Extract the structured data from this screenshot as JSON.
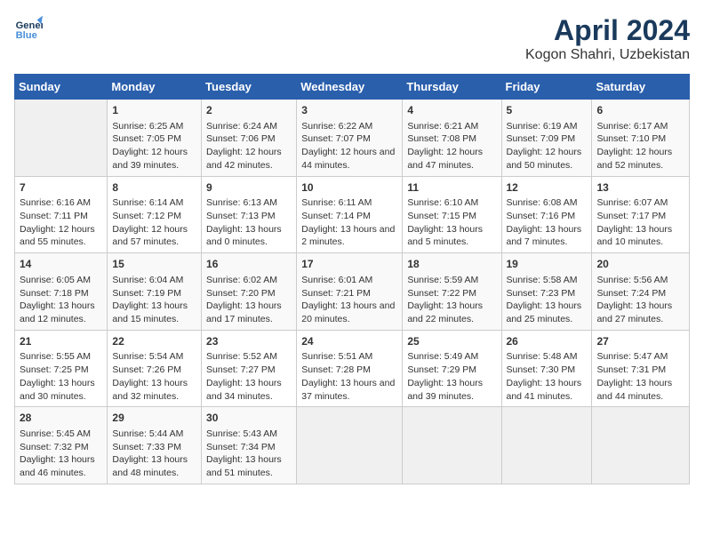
{
  "header": {
    "logo_line1": "General",
    "logo_line2": "Blue",
    "month": "April 2024",
    "location": "Kogon Shahri, Uzbekistan"
  },
  "weekdays": [
    "Sunday",
    "Monday",
    "Tuesday",
    "Wednesday",
    "Thursday",
    "Friday",
    "Saturday"
  ],
  "weeks": [
    [
      {
        "day": "",
        "sunrise": "",
        "sunset": "",
        "daylight": "",
        "empty": true
      },
      {
        "day": "1",
        "sunrise": "Sunrise: 6:25 AM",
        "sunset": "Sunset: 7:05 PM",
        "daylight": "Daylight: 12 hours and 39 minutes."
      },
      {
        "day": "2",
        "sunrise": "Sunrise: 6:24 AM",
        "sunset": "Sunset: 7:06 PM",
        "daylight": "Daylight: 12 hours and 42 minutes."
      },
      {
        "day": "3",
        "sunrise": "Sunrise: 6:22 AM",
        "sunset": "Sunset: 7:07 PM",
        "daylight": "Daylight: 12 hours and 44 minutes."
      },
      {
        "day": "4",
        "sunrise": "Sunrise: 6:21 AM",
        "sunset": "Sunset: 7:08 PM",
        "daylight": "Daylight: 12 hours and 47 minutes."
      },
      {
        "day": "5",
        "sunrise": "Sunrise: 6:19 AM",
        "sunset": "Sunset: 7:09 PM",
        "daylight": "Daylight: 12 hours and 50 minutes."
      },
      {
        "day": "6",
        "sunrise": "Sunrise: 6:17 AM",
        "sunset": "Sunset: 7:10 PM",
        "daylight": "Daylight: 12 hours and 52 minutes."
      }
    ],
    [
      {
        "day": "7",
        "sunrise": "Sunrise: 6:16 AM",
        "sunset": "Sunset: 7:11 PM",
        "daylight": "Daylight: 12 hours and 55 minutes."
      },
      {
        "day": "8",
        "sunrise": "Sunrise: 6:14 AM",
        "sunset": "Sunset: 7:12 PM",
        "daylight": "Daylight: 12 hours and 57 minutes."
      },
      {
        "day": "9",
        "sunrise": "Sunrise: 6:13 AM",
        "sunset": "Sunset: 7:13 PM",
        "daylight": "Daylight: 13 hours and 0 minutes."
      },
      {
        "day": "10",
        "sunrise": "Sunrise: 6:11 AM",
        "sunset": "Sunset: 7:14 PM",
        "daylight": "Daylight: 13 hours and 2 minutes."
      },
      {
        "day": "11",
        "sunrise": "Sunrise: 6:10 AM",
        "sunset": "Sunset: 7:15 PM",
        "daylight": "Daylight: 13 hours and 5 minutes."
      },
      {
        "day": "12",
        "sunrise": "Sunrise: 6:08 AM",
        "sunset": "Sunset: 7:16 PM",
        "daylight": "Daylight: 13 hours and 7 minutes."
      },
      {
        "day": "13",
        "sunrise": "Sunrise: 6:07 AM",
        "sunset": "Sunset: 7:17 PM",
        "daylight": "Daylight: 13 hours and 10 minutes."
      }
    ],
    [
      {
        "day": "14",
        "sunrise": "Sunrise: 6:05 AM",
        "sunset": "Sunset: 7:18 PM",
        "daylight": "Daylight: 13 hours and 12 minutes."
      },
      {
        "day": "15",
        "sunrise": "Sunrise: 6:04 AM",
        "sunset": "Sunset: 7:19 PM",
        "daylight": "Daylight: 13 hours and 15 minutes."
      },
      {
        "day": "16",
        "sunrise": "Sunrise: 6:02 AM",
        "sunset": "Sunset: 7:20 PM",
        "daylight": "Daylight: 13 hours and 17 minutes."
      },
      {
        "day": "17",
        "sunrise": "Sunrise: 6:01 AM",
        "sunset": "Sunset: 7:21 PM",
        "daylight": "Daylight: 13 hours and 20 minutes."
      },
      {
        "day": "18",
        "sunrise": "Sunrise: 5:59 AM",
        "sunset": "Sunset: 7:22 PM",
        "daylight": "Daylight: 13 hours and 22 minutes."
      },
      {
        "day": "19",
        "sunrise": "Sunrise: 5:58 AM",
        "sunset": "Sunset: 7:23 PM",
        "daylight": "Daylight: 13 hours and 25 minutes."
      },
      {
        "day": "20",
        "sunrise": "Sunrise: 5:56 AM",
        "sunset": "Sunset: 7:24 PM",
        "daylight": "Daylight: 13 hours and 27 minutes."
      }
    ],
    [
      {
        "day": "21",
        "sunrise": "Sunrise: 5:55 AM",
        "sunset": "Sunset: 7:25 PM",
        "daylight": "Daylight: 13 hours and 30 minutes."
      },
      {
        "day": "22",
        "sunrise": "Sunrise: 5:54 AM",
        "sunset": "Sunset: 7:26 PM",
        "daylight": "Daylight: 13 hours and 32 minutes."
      },
      {
        "day": "23",
        "sunrise": "Sunrise: 5:52 AM",
        "sunset": "Sunset: 7:27 PM",
        "daylight": "Daylight: 13 hours and 34 minutes."
      },
      {
        "day": "24",
        "sunrise": "Sunrise: 5:51 AM",
        "sunset": "Sunset: 7:28 PM",
        "daylight": "Daylight: 13 hours and 37 minutes."
      },
      {
        "day": "25",
        "sunrise": "Sunrise: 5:49 AM",
        "sunset": "Sunset: 7:29 PM",
        "daylight": "Daylight: 13 hours and 39 minutes."
      },
      {
        "day": "26",
        "sunrise": "Sunrise: 5:48 AM",
        "sunset": "Sunset: 7:30 PM",
        "daylight": "Daylight: 13 hours and 41 minutes."
      },
      {
        "day": "27",
        "sunrise": "Sunrise: 5:47 AM",
        "sunset": "Sunset: 7:31 PM",
        "daylight": "Daylight: 13 hours and 44 minutes."
      }
    ],
    [
      {
        "day": "28",
        "sunrise": "Sunrise: 5:45 AM",
        "sunset": "Sunset: 7:32 PM",
        "daylight": "Daylight: 13 hours and 46 minutes."
      },
      {
        "day": "29",
        "sunrise": "Sunrise: 5:44 AM",
        "sunset": "Sunset: 7:33 PM",
        "daylight": "Daylight: 13 hours and 48 minutes."
      },
      {
        "day": "30",
        "sunrise": "Sunrise: 5:43 AM",
        "sunset": "Sunset: 7:34 PM",
        "daylight": "Daylight: 13 hours and 51 minutes."
      },
      {
        "day": "",
        "sunrise": "",
        "sunset": "",
        "daylight": "",
        "empty": true
      },
      {
        "day": "",
        "sunrise": "",
        "sunset": "",
        "daylight": "",
        "empty": true
      },
      {
        "day": "",
        "sunrise": "",
        "sunset": "",
        "daylight": "",
        "empty": true
      },
      {
        "day": "",
        "sunrise": "",
        "sunset": "",
        "daylight": "",
        "empty": true
      }
    ]
  ]
}
